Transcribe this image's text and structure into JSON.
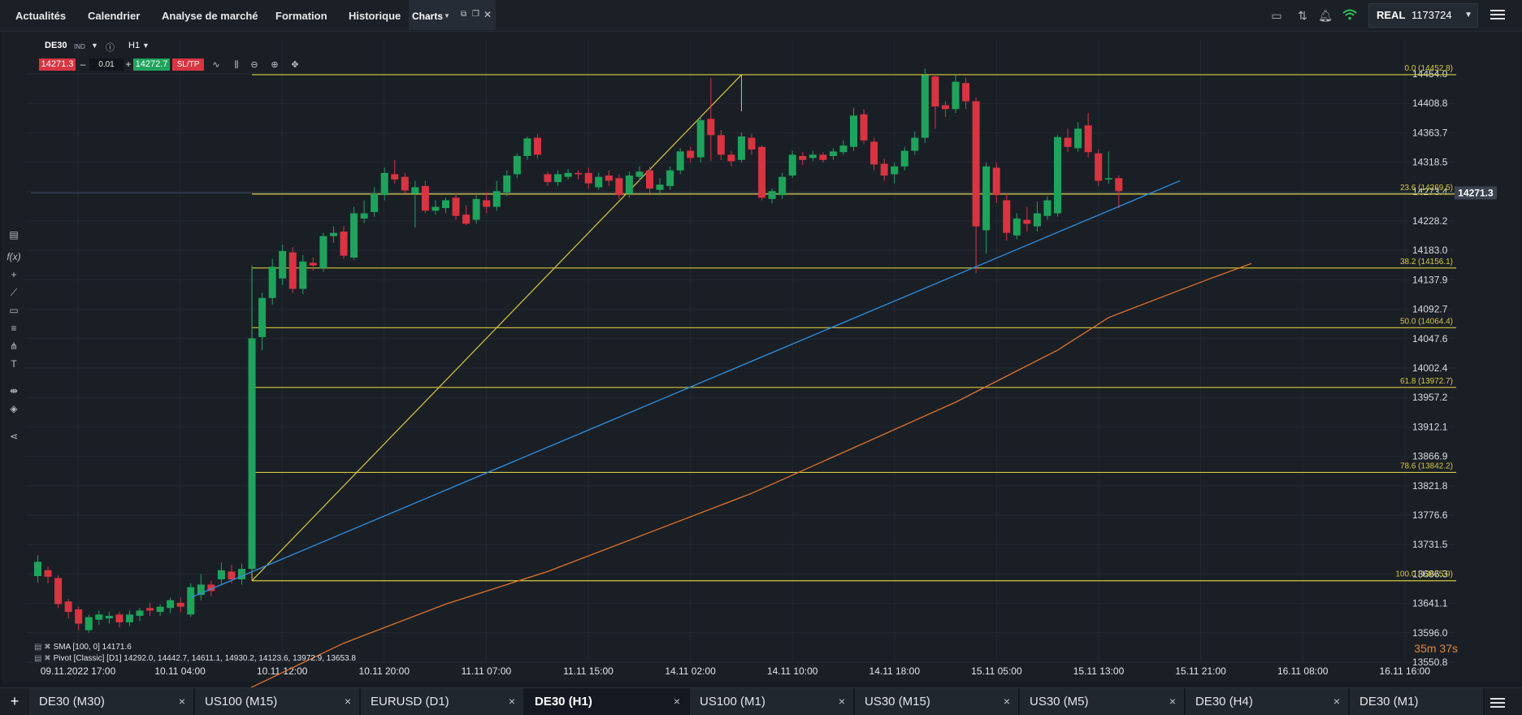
{
  "nav": {
    "items": [
      "Actualités",
      "Calendrier",
      "Analyse de marché",
      "Formation",
      "Historique"
    ],
    "charts_label": "Charts"
  },
  "account": {
    "mode": "REAL",
    "number": "1173724"
  },
  "chart_header": {
    "symbol": "DE30",
    "tag": "IND",
    "timeframe": "H1",
    "sell_price": "14271.3",
    "buy_price": "14272.7",
    "quantity": "0.01",
    "minus": "–",
    "plus": "+",
    "sltp": "SL/TP"
  },
  "chart_data": {
    "type": "candlestick",
    "ylim": [
      13550.8,
      14454.0
    ],
    "y_ticks": [
      "14454.0",
      "14408.8",
      "14363.7",
      "14318.5",
      "14273.4",
      "14228.2",
      "14183.0",
      "14137.9",
      "14092.7",
      "14047.6",
      "14002.4",
      "13957.2",
      "13912.1",
      "13866.9",
      "13821.8",
      "13776.6",
      "13731.5",
      "13686.3",
      "13641.1",
      "13596.0",
      "13550.8"
    ],
    "current_price": "14271.3",
    "x_ticks": [
      "09.11.2022 17:00",
      "10.11 04:00",
      "10.11 12:00",
      "10.11 20:00",
      "11.11 07:00",
      "11.11 15:00",
      "14.11 02:00",
      "14.11 10:00",
      "14.11 18:00",
      "15.11 05:00",
      "15.11 13:00",
      "15.11 21:00",
      "16.11 08:00",
      "16.11 16:00"
    ],
    "fib_levels": [
      {
        "label": "0.0 (14452.8)",
        "price": 14452.8
      },
      {
        "label": "23.6 (14269.5)",
        "price": 14269.5
      },
      {
        "label": "38.2 (14156.1)",
        "price": 14156.1
      },
      {
        "label": "50.0 (14064.4)",
        "price": 14064.4
      },
      {
        "label": "61.8 (13972.7)",
        "price": 13972.7
      },
      {
        "label": "78.6 (13842.2)",
        "price": 13842.2
      },
      {
        "label": "100.0 (13675.9)",
        "price": 13675.9
      }
    ],
    "candles": [
      [
        13683,
        13705,
        13673,
        13715
      ],
      [
        13692,
        13682,
        13672,
        13698
      ],
      [
        13680,
        13640,
        13634,
        13684
      ],
      [
        13644,
        13628,
        13618,
        13648
      ],
      [
        13632,
        13610,
        13600,
        13636
      ],
      [
        13600,
        13620,
        13596,
        13624
      ],
      [
        13616,
        13624,
        13608,
        13630
      ],
      [
        13618,
        13622,
        13610,
        13628
      ],
      [
        13624,
        13612,
        13604,
        13628
      ],
      [
        13612,
        13624,
        13606,
        13630
      ],
      [
        13622,
        13630,
        13614,
        13634
      ],
      [
        13634,
        13630,
        13622,
        13642
      ],
      [
        13628,
        13636,
        13622,
        13640
      ],
      [
        13634,
        13646,
        13626,
        13650
      ],
      [
        13642,
        13636,
        13628,
        13650
      ],
      [
        13624,
        13666,
        13620,
        13672
      ],
      [
        13654,
        13670,
        13646,
        13686
      ],
      [
        13670,
        13660,
        13652,
        13676
      ],
      [
        13678,
        13692,
        13670,
        13704
      ],
      [
        13690,
        13678,
        13672,
        13700
      ],
      [
        13678,
        13694,
        13670,
        13702
      ],
      [
        13694,
        14048,
        13688,
        14160
      ],
      [
        14050,
        14110,
        14030,
        14118
      ],
      [
        14110,
        14158,
        14100,
        14170
      ],
      [
        14140,
        14182,
        14130,
        14192
      ],
      [
        14180,
        14124,
        14118,
        14188
      ],
      [
        14124,
        14166,
        14116,
        14176
      ],
      [
        14164,
        14160,
        14152,
        14172
      ],
      [
        14156,
        14205,
        14150,
        14210
      ],
      [
        14205,
        14210,
        14195,
        14220
      ],
      [
        14212,
        14175,
        14170,
        14220
      ],
      [
        14172,
        14240,
        14168,
        14250
      ],
      [
        14232,
        14240,
        14225,
        14260
      ],
      [
        14242,
        14270,
        14235,
        14280
      ],
      [
        14268,
        14302,
        14260,
        14310
      ],
      [
        14300,
        14292,
        14286,
        14322
      ],
      [
        14296,
        14275,
        14270,
        14302
      ],
      [
        14270,
        14280,
        14218,
        14290
      ],
      [
        14282,
        14244,
        14240,
        14290
      ],
      [
        14244,
        14250,
        14238,
        14260
      ],
      [
        14248,
        14260,
        14240,
        14264
      ],
      [
        14264,
        14236,
        14230,
        14270
      ],
      [
        14238,
        14224,
        14222,
        14252
      ],
      [
        14230,
        14262,
        14224,
        14268
      ],
      [
        14260,
        14250,
        14240,
        14272
      ],
      [
        14250,
        14274,
        14244,
        14290
      ],
      [
        14272,
        14298,
        14266,
        14306
      ],
      [
        14300,
        14328,
        14294,
        14332
      ],
      [
        14328,
        14355,
        14322,
        14358
      ],
      [
        14356,
        14330,
        14324,
        14362
      ],
      [
        14300,
        14288,
        14282,
        14304
      ],
      [
        14288,
        14300,
        14282,
        14306
      ],
      [
        14296,
        14302,
        14292,
        14308
      ],
      [
        14302,
        14300,
        14292,
        14306
      ],
      [
        14302,
        14286,
        14278,
        14310
      ],
      [
        14280,
        14296,
        14276,
        14302
      ],
      [
        14298,
        14290,
        14282,
        14306
      ],
      [
        14294,
        14268,
        14262,
        14300
      ],
      [
        14270,
        14298,
        14264,
        14304
      ],
      [
        14296,
        14304,
        14290,
        14312
      ],
      [
        14306,
        14278,
        14270,
        14312
      ],
      [
        14276,
        14284,
        14270,
        14294
      ],
      [
        14282,
        14306,
        14276,
        14312
      ],
      [
        14306,
        14335,
        14300,
        14340
      ],
      [
        14336,
        14325,
        14318,
        14342
      ],
      [
        14326,
        14383,
        14318,
        14388
      ],
      [
        14385,
        14360,
        14320,
        14448
      ],
      [
        14360,
        14330,
        14322,
        14368
      ],
      [
        14330,
        14320,
        14312,
        14336
      ],
      [
        14322,
        14358,
        14318,
        14364
      ],
      [
        14356,
        14338,
        14330,
        14362
      ],
      [
        14342,
        14264,
        14260,
        14344
      ],
      [
        14262,
        14274,
        14255,
        14278
      ],
      [
        14268,
        14296,
        14262,
        14302
      ],
      [
        14298,
        14330,
        14294,
        14336
      ],
      [
        14328,
        14322,
        14314,
        14334
      ],
      [
        14325,
        14330,
        14320,
        14336
      ],
      [
        14330,
        14322,
        14318,
        14334
      ],
      [
        14328,
        14335,
        14322,
        14340
      ],
      [
        14334,
        14344,
        14330,
        14352
      ],
      [
        14342,
        14390,
        14336,
        14402
      ],
      [
        14392,
        14352,
        14346,
        14400
      ],
      [
        14350,
        14315,
        14306,
        14356
      ],
      [
        14316,
        14298,
        14290,
        14324
      ],
      [
        14300,
        14312,
        14286,
        14318
      ],
      [
        14312,
        14336,
        14306,
        14342
      ],
      [
        14336,
        14356,
        14330,
        14366
      ],
      [
        14356,
        14452,
        14348,
        14462
      ],
      [
        14450,
        14404,
        14370,
        14454
      ],
      [
        14406,
        14400,
        14388,
        14412
      ],
      [
        14400,
        14442,
        14394,
        14452
      ],
      [
        14440,
        14412,
        14400,
        14448
      ],
      [
        14412,
        14220,
        14148,
        14418
      ],
      [
        14214,
        14312,
        14178,
        14318
      ],
      [
        14310,
        14268,
        14256,
        14318
      ],
      [
        14260,
        14210,
        14198,
        14270
      ],
      [
        14206,
        14232,
        14200,
        14240
      ],
      [
        14230,
        14224,
        14212,
        14250
      ],
      [
        14220,
        14240,
        14212,
        14258
      ],
      [
        14236,
        14260,
        14230,
        14266
      ],
      [
        14240,
        14357,
        14235,
        14360
      ],
      [
        14356,
        14342,
        14334,
        14370
      ],
      [
        14340,
        14370,
        14335,
        14380
      ],
      [
        14375,
        14334,
        14326,
        14394
      ],
      [
        14332,
        14290,
        14282,
        14338
      ],
      [
        14292,
        14294,
        14285,
        14335
      ],
      [
        14294,
        14274,
        14248,
        14298
      ]
    ],
    "trend_fib": {
      "from_candle": 21,
      "from_price": 13675.9,
      "to_candle": 69,
      "to_price": 14452.8
    },
    "trend_blue": {
      "from_candle": 15,
      "from_price": 13650,
      "to_candle": 112,
      "to_price": 14290
    },
    "sma100": [
      [
        20,
        13505
      ],
      [
        30,
        13580
      ],
      [
        40,
        13640
      ],
      [
        50,
        13690
      ],
      [
        60,
        13750
      ],
      [
        70,
        13810
      ],
      [
        80,
        13880
      ],
      [
        90,
        13950
      ],
      [
        100,
        14030
      ],
      [
        105,
        14080
      ],
      [
        110,
        14110
      ],
      [
        115,
        14140
      ],
      [
        119,
        14163
      ]
    ]
  },
  "legends": {
    "sma": "SMA [100, 0] 14171.6",
    "pivot": "Pivot [Classic] [D1] 14292.0, 14442.7, 14611.1, 14930.2, 14123.6, 13972.9, 13653.8"
  },
  "countdown": "35m 37s",
  "colors": {
    "up": "#1fa35c",
    "down": "#d93441",
    "fib": "#d6c83e",
    "trend": "#2f8fe0",
    "sma": "#e0732c",
    "bg": "#1a1f26",
    "grid": "#222831"
  },
  "bottom_tabs": [
    {
      "label": "DE30 (M30)",
      "active": false
    },
    {
      "label": "US100 (M15)",
      "active": false
    },
    {
      "label": "EURUSD (D1)",
      "active": false
    },
    {
      "label": "DE30 (H1)",
      "active": true
    },
    {
      "label": "US100 (M1)",
      "active": false
    },
    {
      "label": "US30 (M15)",
      "active": false
    },
    {
      "label": "US30 (M5)",
      "active": false
    },
    {
      "label": "DE30 (H4)",
      "active": false
    },
    {
      "label": "DE30 (M1)",
      "active": false
    }
  ],
  "add_tab_label": "+",
  "close_symbol": "×"
}
